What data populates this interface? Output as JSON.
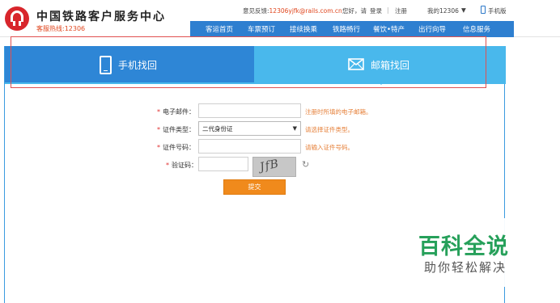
{
  "header": {
    "site_title": "中国铁路客户服务中心",
    "hotline": "客服热线:12306",
    "feedback_label": "意见反馈:",
    "feedback_email": "12306yjfk@rails.com.cn",
    "greeting": "您好，请",
    "login": "登录",
    "separator": "|",
    "register": "注册",
    "my12306": "我的12306",
    "mobile": "手机版",
    "nav": [
      "客运首页",
      "车票预订",
      "接续换乘",
      "铁路畅行",
      "餐饮•特产",
      "出行向导",
      "信息服务"
    ]
  },
  "tabs": {
    "phone": "手机找回",
    "email": "邮箱找回"
  },
  "form": {
    "email_label": "电子邮件：",
    "email_hint": "注册时所填的电子邮箱。",
    "idtype_label": "证件类型：",
    "idtype_value": "二代身份证",
    "idtype_hint": "请选择证件类型。",
    "idno_label": "证件号码：",
    "idno_hint": "请输入证件号码。",
    "captcha_label": "验证码：",
    "captcha_text": "JfB",
    "submit": "提交"
  },
  "watermark": {
    "title": "百科全说",
    "subtitle": "助你轻松解决"
  },
  "colors": {
    "nav_blue": "#2e7fd0",
    "tab_active": "#2e86d6",
    "tab_inactive": "#49b8ec",
    "accent_orange": "#f08a1c",
    "brand_red": "#d8262c"
  }
}
